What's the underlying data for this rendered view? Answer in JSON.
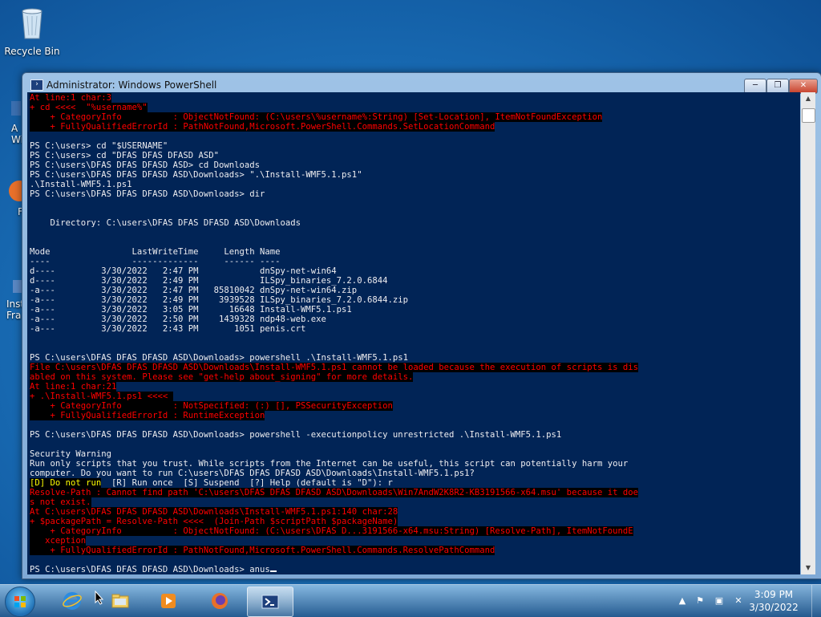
{
  "desktop": {
    "icons": [
      {
        "label": "Recycle Bin",
        "icon": "recycle-bin-icon"
      }
    ],
    "partial_icons": [
      {
        "label": "A\nWi",
        "icon": "app-icon"
      },
      {
        "label": "F",
        "icon": "firefox-icon"
      },
      {
        "label": "Inst\nFra",
        "icon": "installer-icon"
      }
    ]
  },
  "window": {
    "title": "Administrator: Windows PowerShell",
    "icon": "powershell-icon",
    "controls": {
      "minimize": "─",
      "maximize": "❐",
      "close": "✕"
    }
  },
  "console": {
    "colors": {
      "background": "#012456",
      "text": "#eeedf0",
      "error": "#ff0000",
      "warning": "#ffff00"
    },
    "lines": [
      {
        "t": "At line:1 char:3",
        "k": "err"
      },
      {
        "t": "+ cd <<<<  \"%username%\"",
        "k": "err"
      },
      {
        "t": "    + CategoryInfo          : ObjectNotFound: (C:\\users\\%username%:String) [Set-Location], ItemNotFoundException",
        "k": "err"
      },
      {
        "t": "    + FullyQualifiedErrorId : PathNotFound,Microsoft.PowerShell.Commands.SetLocationCommand",
        "k": "err"
      },
      {
        "t": "",
        "k": ""
      },
      {
        "t": "PS C:\\users> cd \"$USERNAME\"",
        "k": ""
      },
      {
        "t": "PS C:\\users> cd \"DFAS DFAS DFASD ASD\"",
        "k": ""
      },
      {
        "t": "PS C:\\users\\DFAS DFAS DFASD ASD> cd Downloads",
        "k": ""
      },
      {
        "t": "PS C:\\users\\DFAS DFAS DFASD ASD\\Downloads> \".\\Install-WMF5.1.ps1\"",
        "k": ""
      },
      {
        "t": ".\\Install-WMF5.1.ps1",
        "k": ""
      },
      {
        "t": "PS C:\\users\\DFAS DFAS DFASD ASD\\Downloads> dir",
        "k": ""
      },
      {
        "t": "",
        "k": ""
      },
      {
        "t": "",
        "k": ""
      },
      {
        "t": "    Directory: C:\\users\\DFAS DFAS DFASD ASD\\Downloads",
        "k": ""
      },
      {
        "t": "",
        "k": ""
      },
      {
        "t": "",
        "k": ""
      },
      {
        "t": "Mode                LastWriteTime     Length Name",
        "k": ""
      },
      {
        "t": "----                -------------     ------ ----",
        "k": ""
      },
      {
        "t": "d----         3/30/2022   2:47 PM            dnSpy-net-win64",
        "k": ""
      },
      {
        "t": "d----         3/30/2022   2:49 PM            ILSpy_binaries_7.2.0.6844",
        "k": ""
      },
      {
        "t": "-a---         3/30/2022   2:47 PM   85810042 dnSpy-net-win64.zip",
        "k": ""
      },
      {
        "t": "-a---         3/30/2022   2:49 PM    3939528 ILSpy_binaries_7.2.0.6844.zip",
        "k": ""
      },
      {
        "t": "-a---         3/30/2022   3:05 PM      16648 Install-WMF5.1.ps1",
        "k": ""
      },
      {
        "t": "-a---         3/30/2022   2:50 PM    1439328 ndp48-web.exe",
        "k": ""
      },
      {
        "t": "-a---         3/30/2022   2:43 PM       1051 penis.crt",
        "k": ""
      },
      {
        "t": "",
        "k": ""
      },
      {
        "t": "",
        "k": ""
      },
      {
        "t": "PS C:\\users\\DFAS DFAS DFASD ASD\\Downloads> powershell .\\Install-WMF5.1.ps1",
        "k": ""
      },
      {
        "t": "File C:\\users\\DFAS DFAS DFASD ASD\\Downloads\\Install-WMF5.1.ps1 cannot be loaded because the execution of scripts is dis",
        "k": "err"
      },
      {
        "t": "abled on this system. Please see \"get-help about_signing\" for more details.",
        "k": "err"
      },
      {
        "t": "At line:1 char:21",
        "k": "err"
      },
      {
        "t": "+ .\\Install-WMF5.1.ps1 <<<< ",
        "k": "err"
      },
      {
        "t": "    + CategoryInfo          : NotSpecified: (:) [], PSSecurityException",
        "k": "err"
      },
      {
        "t": "    + FullyQualifiedErrorId : RuntimeException",
        "k": "err"
      },
      {
        "t": "",
        "k": ""
      },
      {
        "t": "PS C:\\users\\DFAS DFAS DFASD ASD\\Downloads> powershell -executionpolicy unrestricted .\\Install-WMF5.1.ps1",
        "k": ""
      },
      {
        "t": "",
        "k": ""
      },
      {
        "t": "Security Warning",
        "k": ""
      },
      {
        "t": "Run only scripts that you trust. While scripts from the Internet can be useful, this script can potentially harm your",
        "k": ""
      },
      {
        "t": "computer. Do you want to run C:\\users\\DFAS DFAS DFASD ASD\\Downloads\\Install-WMF5.1.ps1?",
        "k": ""
      },
      {
        "t": "[D] Do not run  [R] Run once  [S] Suspend  [?] Help (default is \"D\"): r",
        "k": "mixed"
      },
      {
        "t": "Resolve-Path : Cannot find path 'C:\\users\\DFAS DFAS DFASD ASD\\Downloads\\Win7AndW2K8R2-KB3191566-x64.msu' because it doe",
        "k": "err"
      },
      {
        "t": "s not exist.",
        "k": "err"
      },
      {
        "t": "At C:\\users\\DFAS DFAS DFASD ASD\\Downloads\\Install-WMF5.1.ps1:140 char:28",
        "k": "err"
      },
      {
        "t": "+ $packagePath = Resolve-Path <<<<  (Join-Path $scriptPath $packageName)",
        "k": "err"
      },
      {
        "t": "    + CategoryInfo          : ObjectNotFound: (C:\\users\\DFAS D...3191566-x64.msu:String) [Resolve-Path], ItemNotFoundE",
        "k": "err"
      },
      {
        "t": "   xception",
        "k": "err"
      },
      {
        "t": "    + FullyQualifiedErrorId : PathNotFound,Microsoft.PowerShell.Commands.ResolvePathCommand",
        "k": "err"
      },
      {
        "t": "",
        "k": ""
      },
      {
        "t": "PS C:\\users\\DFAS DFAS DFASD ASD\\Downloads> anus",
        "k": "prompt"
      }
    ],
    "mixed_warn": "[D] Do not run",
    "mixed_rest": "  [R] Run once  [S] Suspend  [?] Help (default is \"D\"): r"
  },
  "taskbar": {
    "buttons": [
      {
        "name": "internet-explorer",
        "icon": "internet-explorer-icon",
        "active": false
      },
      {
        "name": "windows-explorer",
        "icon": "folder-icon",
        "active": false
      },
      {
        "name": "media-player",
        "icon": "media-player-icon",
        "active": false
      },
      {
        "name": "firefox",
        "icon": "firefox-icon",
        "active": false
      },
      {
        "name": "powershell",
        "icon": "powershell-icon",
        "active": true
      }
    ],
    "tray": {
      "time": "3:09 PM",
      "date": "3/30/2022",
      "icons": [
        "show-hidden-icons-icon",
        "action-center-flag-icon",
        "network-icon",
        "volume-muted-icon"
      ]
    }
  }
}
